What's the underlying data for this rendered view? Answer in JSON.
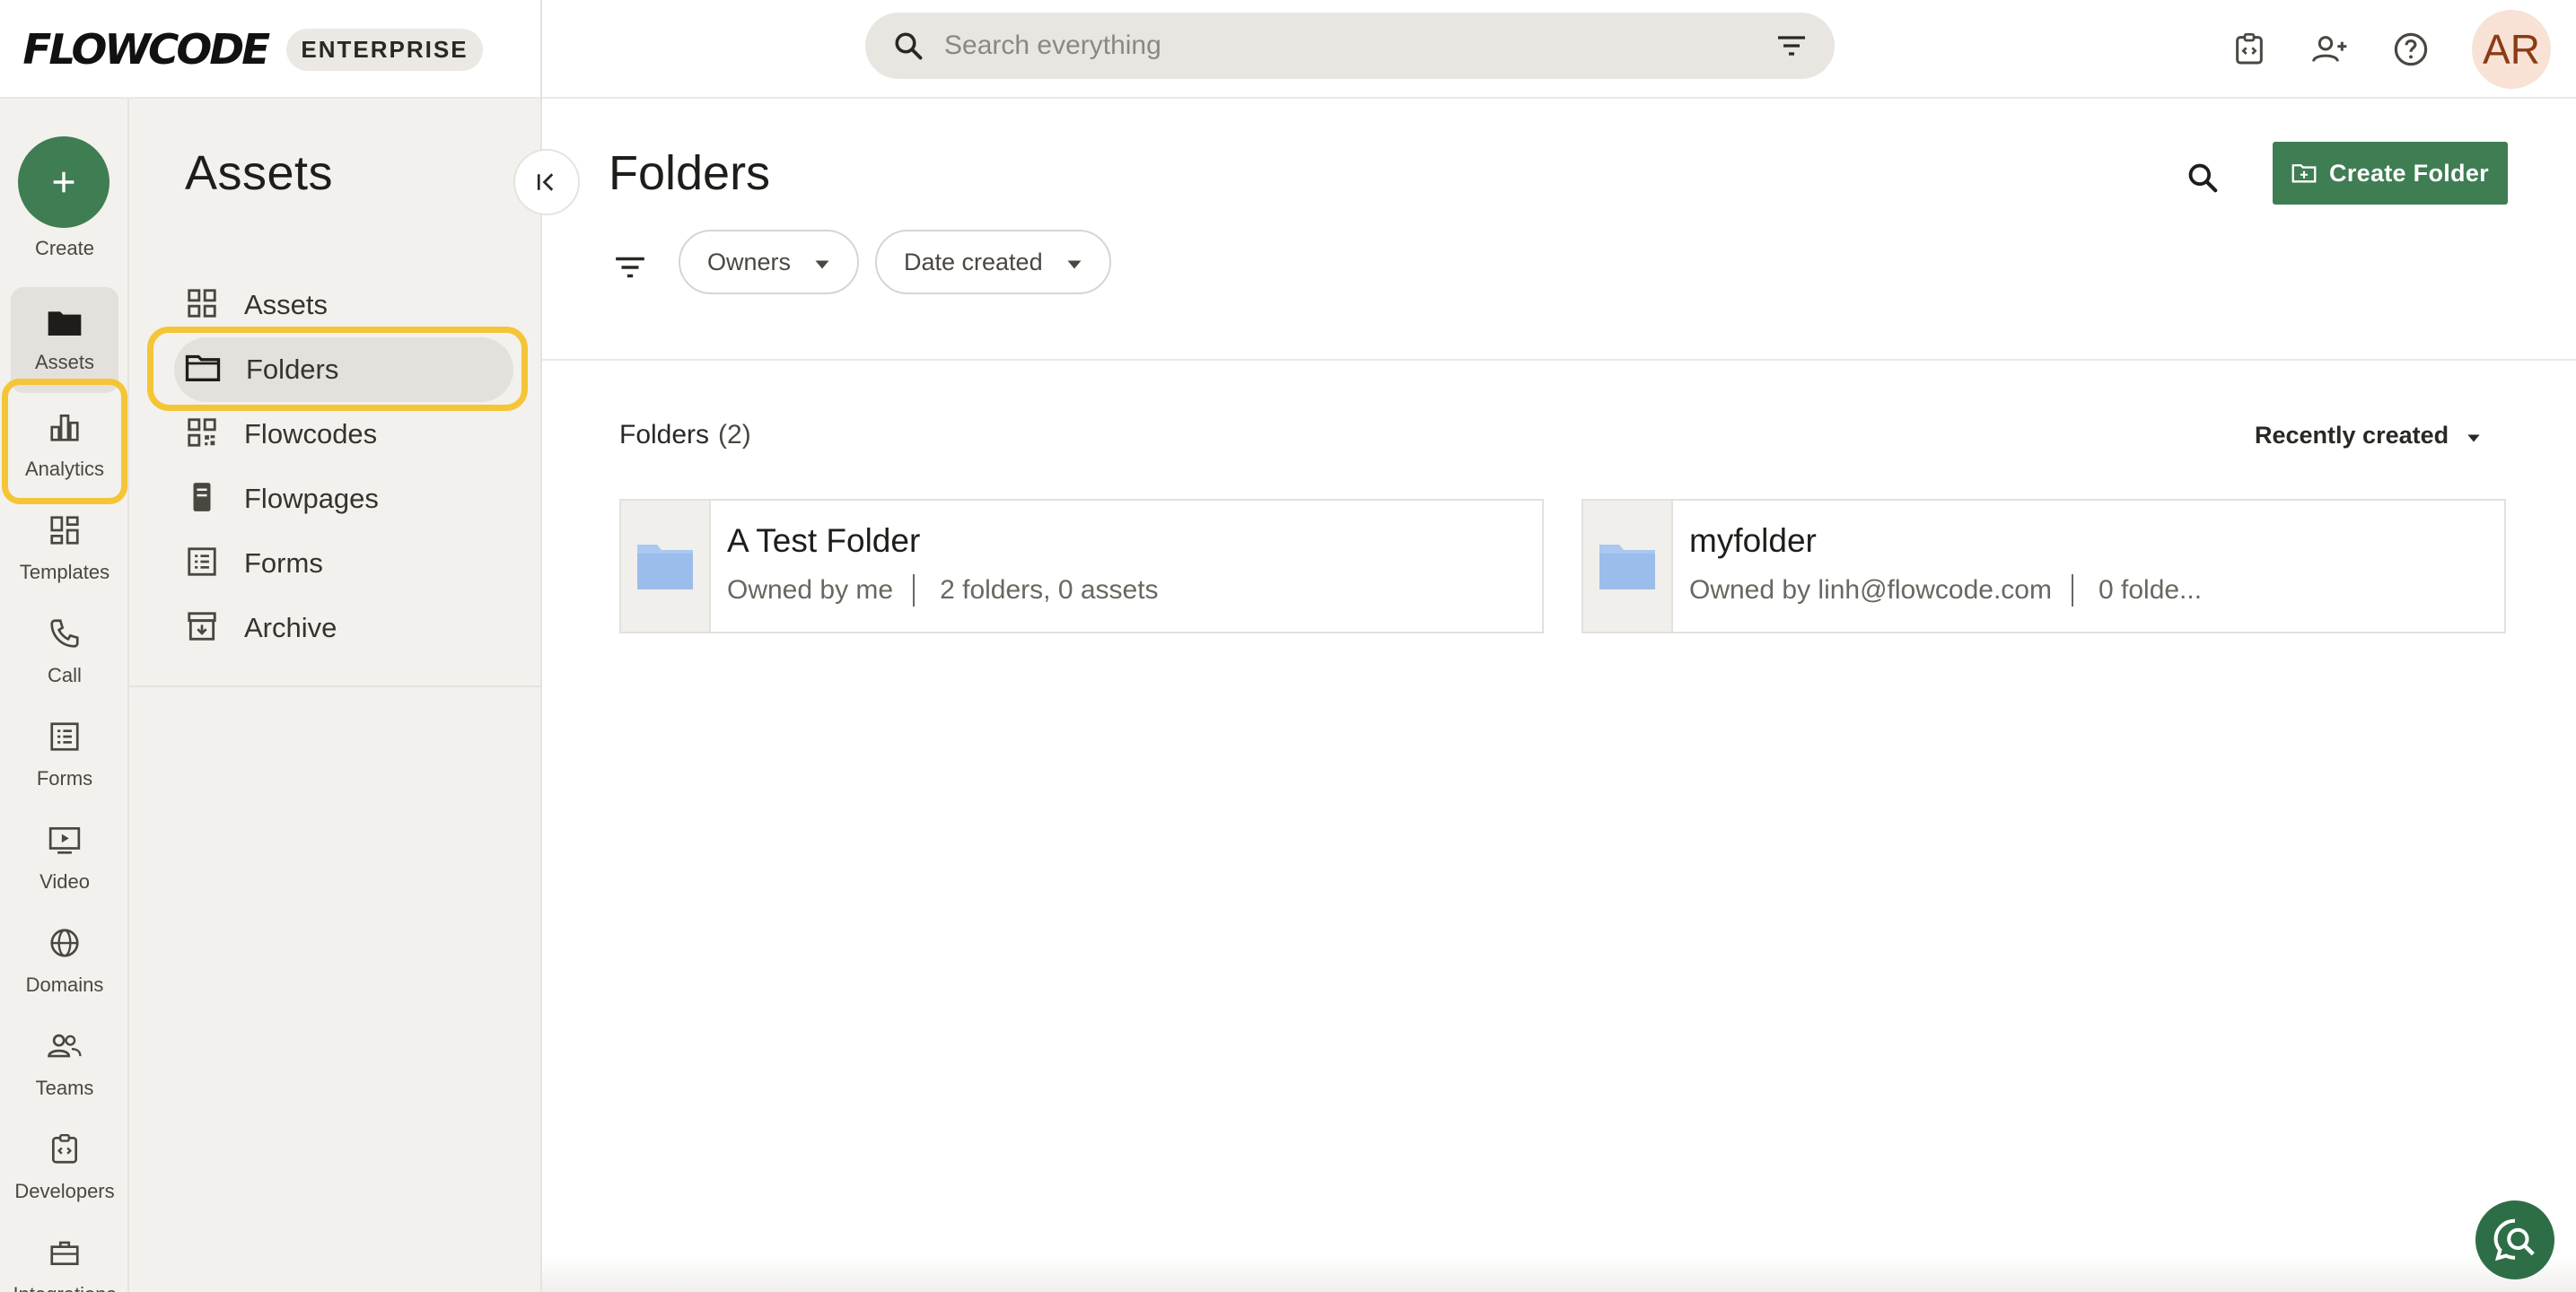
{
  "header": {
    "logo": "FLOWCODE",
    "badge": "ENTERPRISE",
    "search_placeholder": "Search everything",
    "avatar_initials": "AR",
    "icons": [
      "developer-icon",
      "invite-user-icon",
      "help-icon"
    ]
  },
  "rail": {
    "create_label": "Create",
    "items": [
      {
        "label": "Assets",
        "icon": "folder-icon",
        "active": true
      },
      {
        "label": "Analytics",
        "icon": "bar-chart-icon"
      },
      {
        "label": "Templates",
        "icon": "dashboard-icon"
      },
      {
        "label": "Call",
        "icon": "phone-icon"
      },
      {
        "label": "Forms",
        "icon": "list-icon"
      },
      {
        "label": "Video",
        "icon": "video-icon"
      },
      {
        "label": "Domains",
        "icon": "globe-icon"
      },
      {
        "label": "Teams",
        "icon": "people-icon"
      },
      {
        "label": "Developers",
        "icon": "developer-icon"
      },
      {
        "label": "Integrations",
        "icon": "toolbox-icon"
      }
    ]
  },
  "subnav": {
    "title": "Assets",
    "items": [
      {
        "label": "Assets",
        "icon": "grid-icon"
      },
      {
        "label": "Folders",
        "icon": "folder-outline-icon",
        "active": true
      },
      {
        "label": "Flowcodes",
        "icon": "qr-icon"
      },
      {
        "label": "Flowpages",
        "icon": "page-icon"
      },
      {
        "label": "Forms",
        "icon": "list-icon"
      },
      {
        "label": "Archive",
        "icon": "archive-icon"
      }
    ]
  },
  "main": {
    "title": "Folders",
    "create_button": "Create Folder",
    "filters": {
      "owners": "Owners",
      "date_created": "Date created"
    },
    "section": {
      "label": "Folders",
      "count": "(2)"
    },
    "sort": "Recently created",
    "folders": [
      {
        "name": "A Test Folder",
        "owner": "Owned by me",
        "contents": "2 folders, 0 assets"
      },
      {
        "name": "myfolder",
        "owner": "Owned by linh@flowcode.com",
        "contents": "0 folde..."
      }
    ]
  },
  "colors": {
    "accent": "#3f7d52",
    "highlight": "#f4c537",
    "sidebar_bg": "#f3f1ee"
  }
}
